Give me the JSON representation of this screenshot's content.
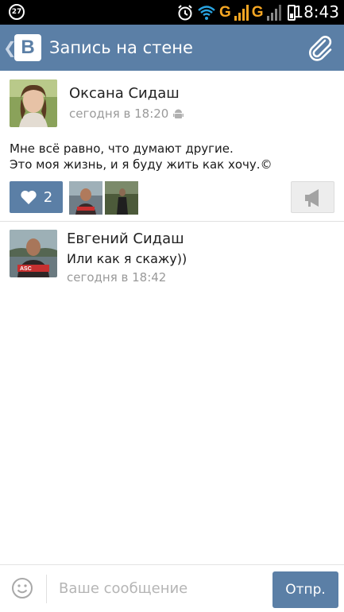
{
  "status_bar": {
    "notification_count": "27",
    "network_type_1": "G",
    "network_type_2": "G",
    "time": "18:43"
  },
  "app_bar": {
    "logo_text": "B",
    "title": "Запись на стене",
    "icon": "paperclip-icon"
  },
  "post": {
    "author": "Оксана Сидаш",
    "time": "сегодня в 18:20",
    "device_icon": "android-icon",
    "text": "Мне всё равно, что думают другие.\nЭто моя жизнь, и я буду жить как хочу.©",
    "likes": "2",
    "colors": {
      "accent": "#5b7fa6",
      "muted": "#9a9a9a"
    }
  },
  "comment": {
    "author": "Евгений Сидаш",
    "text": "Или как я скажу))",
    "time": "сегодня в 18:42"
  },
  "composer": {
    "placeholder": "Ваше сообщение",
    "value": "",
    "send_label": "Отпр."
  }
}
